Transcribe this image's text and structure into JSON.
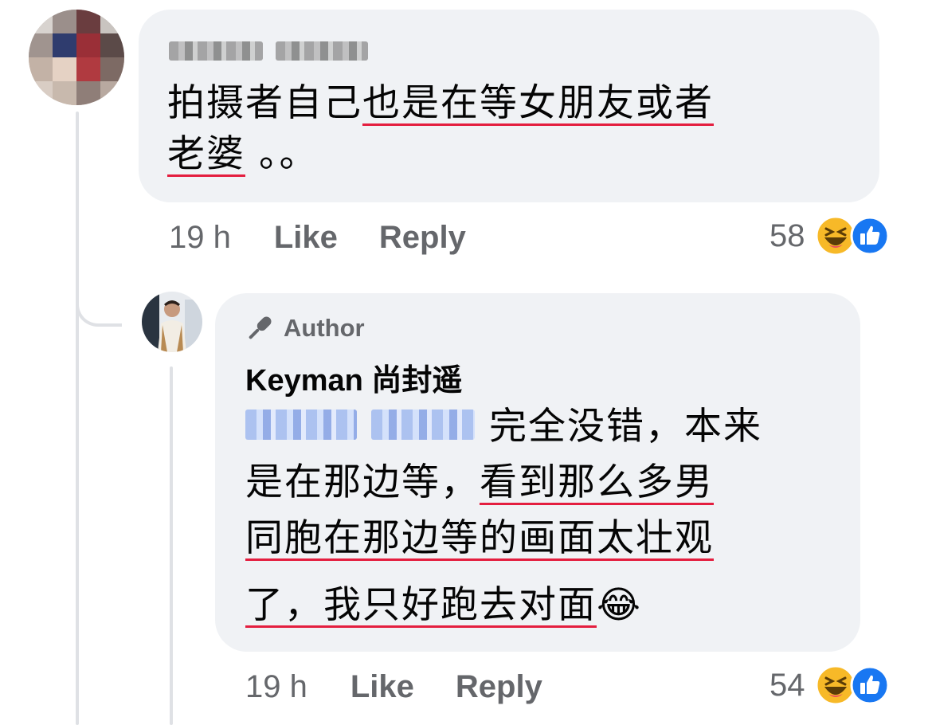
{
  "comment": {
    "author_name": "",
    "text_line1_plain": "拍摄者自己",
    "text_line1_underlined": "也是在等女朋友或者",
    "text_line2_underlined": "老婆",
    "text_line2_plain": "。。",
    "time": "19 h",
    "like_label": "Like",
    "reply_label": "Reply",
    "reaction_count": "58",
    "reaction_icons": [
      "haha-icon",
      "like-icon"
    ]
  },
  "reply": {
    "badge_label": "Author",
    "badge_icon": "microphone-icon",
    "author_name": "Keyman 尚封遥",
    "line1_plain": "完全没错，本来",
    "line2_plain": "是在那边等，",
    "line2_underlined": "看到那么多男",
    "line3_underlined": "同胞在那边等的画面太壮观",
    "line4_underlined": "了，我只好跑去对面",
    "emoji": "😂",
    "time": "19 h",
    "like_label": "Like",
    "reply_label": "Reply",
    "reaction_count": "54",
    "reaction_icons": [
      "haha-icon",
      "like-icon"
    ]
  },
  "colors": {
    "bubble_bg": "#f0f2f5",
    "underline": "#e41e3f",
    "meta_text": "#65676b",
    "like_blue": "#1877f2",
    "haha_yellow": "#f7b928"
  }
}
